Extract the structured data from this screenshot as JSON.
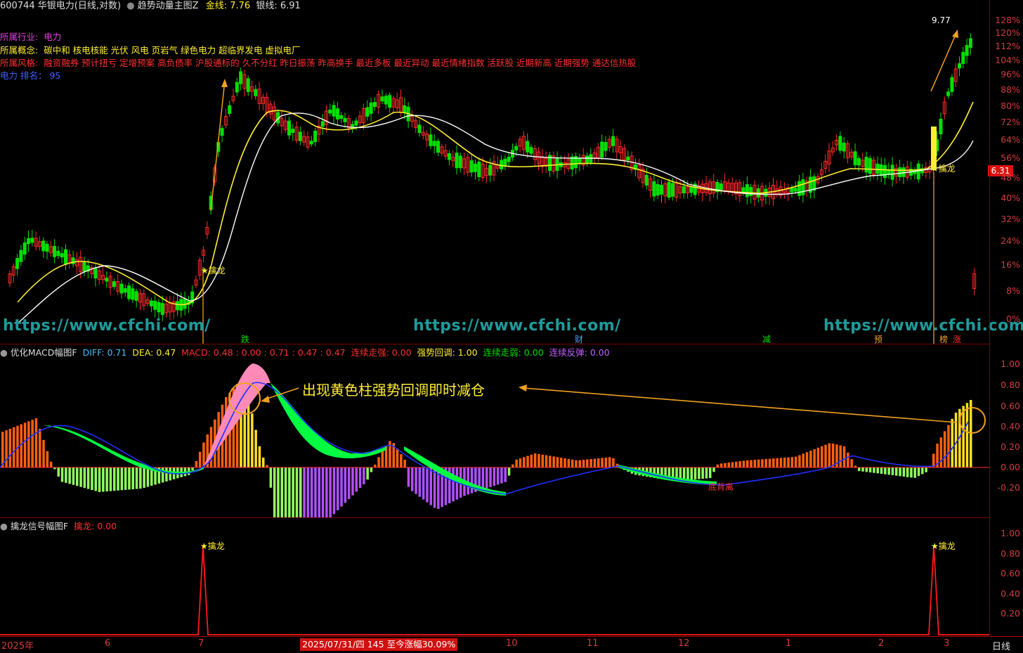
{
  "header": {
    "stock": "600744 华银电力(日线,对数)",
    "indicator": "趋势动量主图Z",
    "gold": "金线: 7.76",
    "silver": "银线: 6.91"
  },
  "info": {
    "industry_label": "所属行业:",
    "industry": "电力",
    "concept_label": "所属概念:",
    "concept": "碳中和 核电核能 光伏 风电 页岩气 绿色电力 超临界发电 虚拟电厂",
    "style_label": "所属风格:",
    "style": "融资融券 预计扭亏 定增预案 高负债率 沪股通标的 久不分红 昨日振荡 昨高换手 最近多板 最近异动 最近情绪指数 活跃股 近期新高 近期强势 通达信热股",
    "rank": "电力   排名： 95"
  },
  "price_axis": [
    "128%",
    "120%",
    "112%",
    "104%",
    "96%",
    "88%",
    "80%",
    "72%",
    "64%",
    "56%",
    "48%",
    "40%",
    "32%",
    "24%",
    "16%",
    "8%",
    "0%"
  ],
  "price_tag": "6.31",
  "high_label": "9.77",
  "signal_label": "★擒龙",
  "watermark": "https://www.cfchi.com/",
  "events": [
    "跌",
    "财",
    "减",
    "预",
    "榜",
    "涨"
  ],
  "macd": {
    "name": "优化MACD幅图F",
    "diff": "DIFF: 0.71",
    "dea": "DEA: 0.47",
    "macd": "MACD: 0.48 : 0.00 : 0.71 : 0.47 : 0.47",
    "lz": "连续走强: 0.00",
    "qs": "强势回调: 1.00",
    "lr": "连续走弱: 0.00",
    "lf": "连续反弹: 0.00",
    "axis": [
      "1.00",
      "0.80",
      "0.60",
      "0.40",
      "0.20",
      "0.00",
      "-0.20"
    ],
    "annotation": "出现黄色柱强势回调即时减仓",
    "divergence": "底背离"
  },
  "signal": {
    "name": "擒龙信号幅图F",
    "value": "擒龙: 0.00",
    "axis": [
      "1.00",
      "0.80",
      "0.60",
      "0.40",
      "0.20"
    ]
  },
  "timeline": {
    "labels": [
      "2025年",
      "6",
      "7",
      "10",
      "11",
      "12",
      "1",
      "2",
      "3"
    ],
    "cursor": "2025/07/31/四 145 至今涨幅30.09%",
    "period": "日线"
  },
  "colors": {
    "up": "#ff2a2a",
    "down": "#00e000",
    "gold": "#ffee33",
    "silver": "#ffffff",
    "macd_line": "#2020ff",
    "accent": "#f0a020"
  }
}
